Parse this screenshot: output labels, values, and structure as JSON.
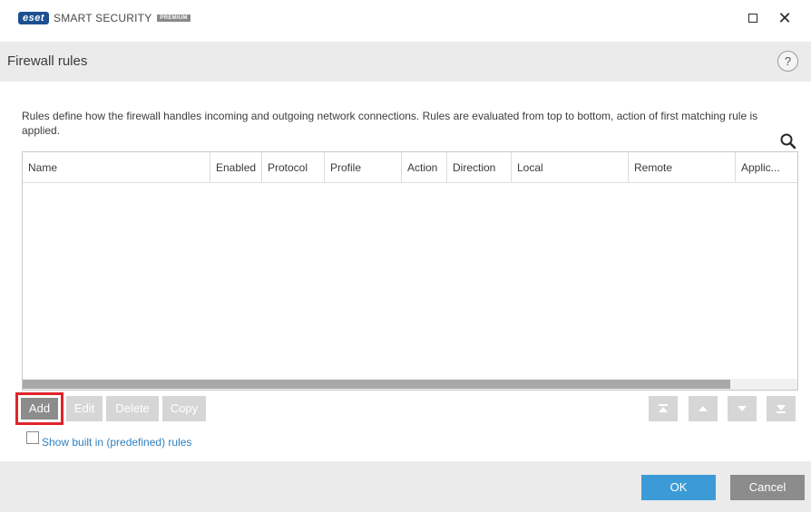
{
  "titlebar": {
    "brand": "eset",
    "product": "SMART SECURITY",
    "edition": "PREMIUM",
    "maximize_icon": "maximize-icon",
    "close_icon": "close-icon",
    "close_glyph": "✕"
  },
  "header": {
    "title": "Firewall rules",
    "help_glyph": "?"
  },
  "description": "Rules define how the firewall handles incoming and outgoing network connections. Rules are evaluated from top to bottom, action of first matching rule is applied.",
  "search_icon": "search-icon",
  "table": {
    "columns": [
      {
        "label": "Name"
      },
      {
        "label": "Enabled"
      },
      {
        "label": "Protocol"
      },
      {
        "label": "Profile"
      },
      {
        "label": "Action"
      },
      {
        "label": "Direction"
      },
      {
        "label": "Local"
      },
      {
        "label": "Remote"
      },
      {
        "label": "Applic..."
      }
    ],
    "rows": []
  },
  "actions": {
    "add": "Add",
    "edit": "Edit",
    "delete": "Delete",
    "copy": "Copy"
  },
  "move_buttons": {
    "top_icon": "move-to-top-icon",
    "up_icon": "move-up-icon",
    "down_icon": "move-down-icon",
    "bottom_icon": "move-to-bottom-icon"
  },
  "checkbox": {
    "label": "Show built in (predefined) rules",
    "checked": false
  },
  "footer": {
    "ok": "OK",
    "cancel": "Cancel"
  },
  "colors": {
    "accent": "#3c9bd6",
    "highlight": "#e0242a",
    "brand": "#1d4f91"
  }
}
